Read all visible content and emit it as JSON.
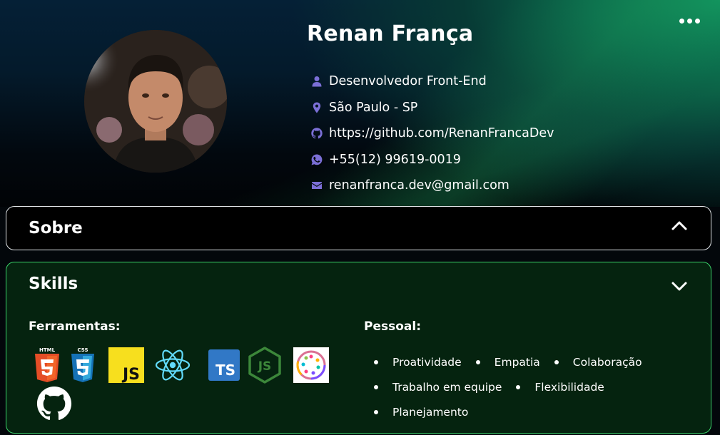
{
  "profile": {
    "name": "Renan França",
    "role": "Desenvolvedor Front-End",
    "location": "São Paulo - SP",
    "github": "https://github.com/RenanFrancaDev",
    "phone": "+55(12) 99619-0019",
    "email": "renanfranca.dev@gmail.com"
  },
  "icons": {
    "menu": "more-horizontal-icon",
    "role": "user-icon",
    "location": "map-pin-icon",
    "github": "github-icon",
    "phone": "whatsapp-icon",
    "email": "mail-icon"
  },
  "sections": {
    "sobre": {
      "title": "Sobre",
      "expanded": false
    },
    "skills": {
      "title": "Skills",
      "expanded": true,
      "tools_title": "Ferramentas:",
      "personal_title": "Pessoal:",
      "tools": [
        {
          "name": "html5-icon",
          "label": "HTML"
        },
        {
          "name": "css3-icon",
          "label": "CSS"
        },
        {
          "name": "javascript-icon",
          "label": "JS"
        },
        {
          "name": "react-icon"
        },
        {
          "name": "typescript-icon",
          "label": "TS"
        },
        {
          "name": "nodejs-icon",
          "label": "JS"
        },
        {
          "name": "styled-components-icon"
        },
        {
          "name": "github-icon"
        }
      ],
      "personal": [
        "Proatividade",
        "Empatia",
        "Colaboração",
        "Trabalho em equipe",
        "Flexibilidade",
        "Planejamento"
      ]
    }
  },
  "colors": {
    "icon_accent": "#7b6fd6",
    "skills_border": "#3bd36a",
    "skills_bg": "#05230f"
  }
}
